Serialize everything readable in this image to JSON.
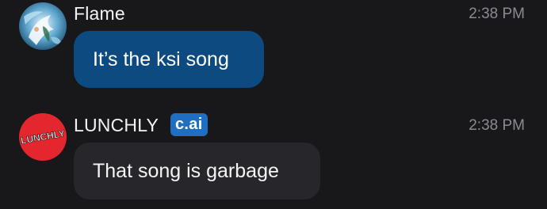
{
  "messages": [
    {
      "author": "Flame",
      "time": "2:38 PM",
      "text": "It’s the ksi song",
      "avatar_icon": "anime-character-avatar",
      "bubble_color": "#0d4a80"
    },
    {
      "author": "LUNCHLY",
      "badge": "c.ai",
      "time": "2:38 PM",
      "text": "That song is garbage",
      "avatar_text": "LUNCHLY",
      "avatar_color": "#e4272f",
      "bubble_color": "#26262b"
    }
  ],
  "colors": {
    "background": "#18181b",
    "badge": "#1e6fc2",
    "timestamp": "#8a8a92"
  }
}
